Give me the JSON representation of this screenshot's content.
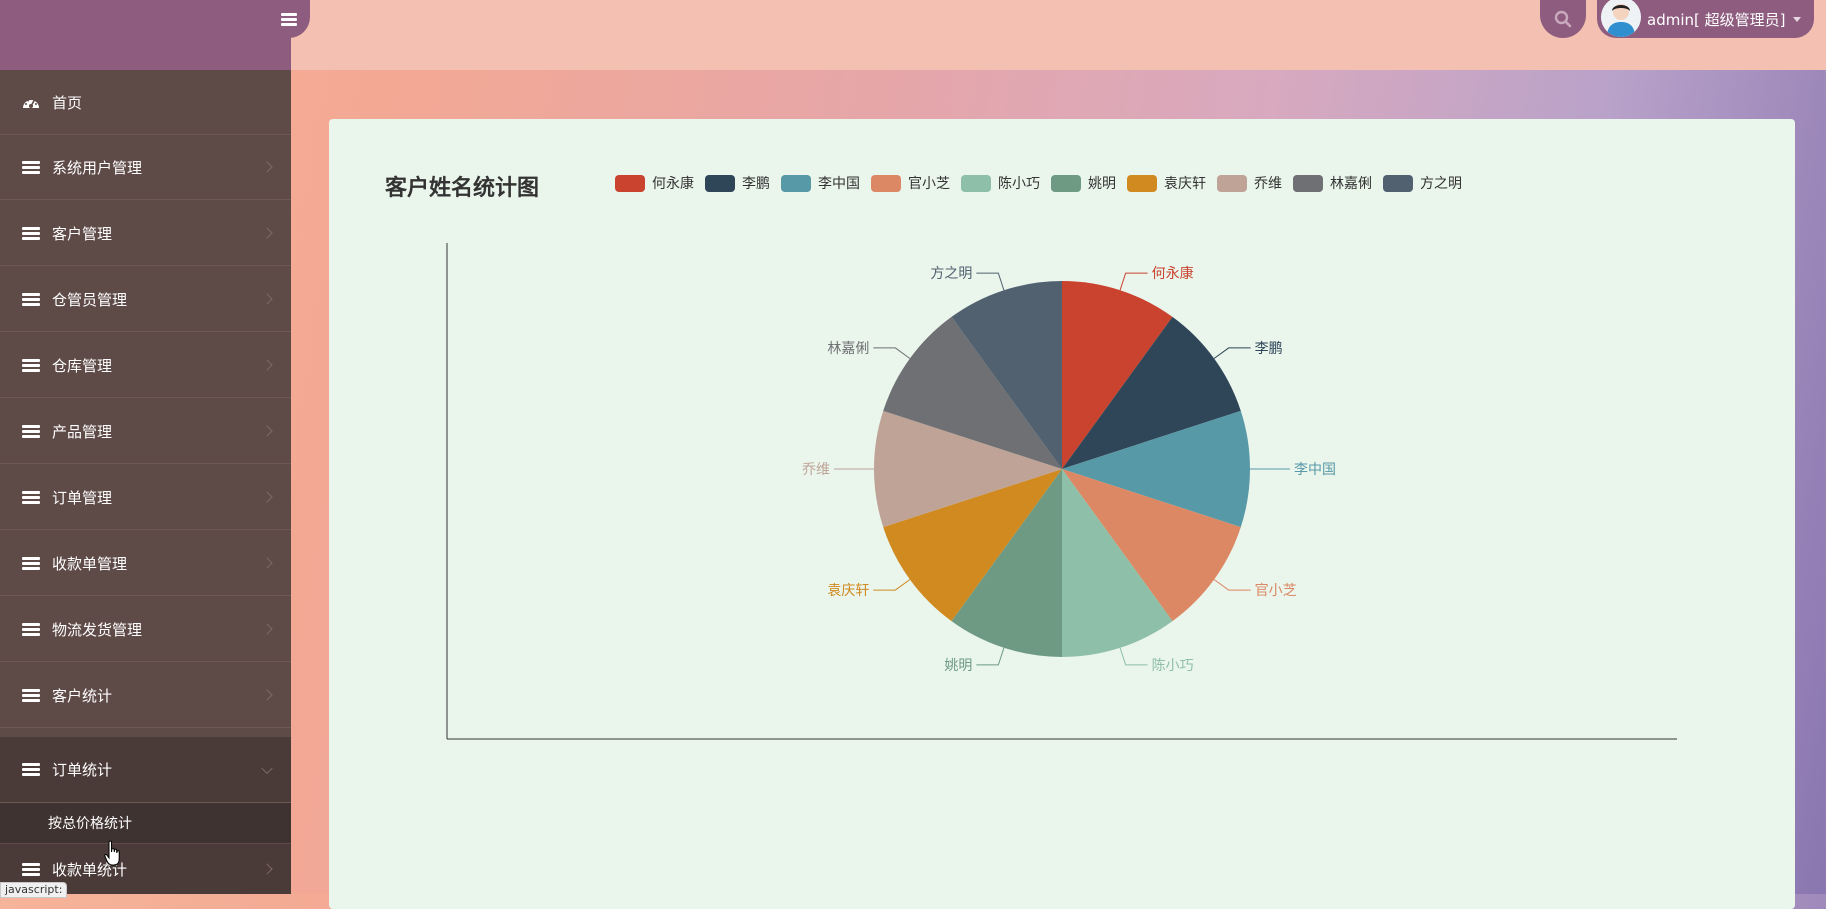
{
  "header": {
    "user_label": "admin[ 超级管理员]"
  },
  "icons": {
    "menu": "bars-icon",
    "search": "search-icon",
    "avatar": "user-avatar-icon",
    "dashboard": "dashboard-icon",
    "module": "stack-icon"
  },
  "sidebar": {
    "items": [
      {
        "label": "首页"
      },
      {
        "label": "系统用户管理"
      },
      {
        "label": "客户管理"
      },
      {
        "label": "仓管员管理"
      },
      {
        "label": "仓库管理"
      },
      {
        "label": "产品管理"
      },
      {
        "label": "订单管理"
      },
      {
        "label": "收款单管理"
      },
      {
        "label": "物流发货管理"
      },
      {
        "label": "客户统计"
      },
      {
        "label": "订单统计"
      },
      {
        "label": "收款单统计"
      }
    ],
    "open_sub": {
      "label": "按总价格统计"
    }
  },
  "status_tip": "javascript:",
  "chart_data": {
    "type": "pie",
    "title": "客户姓名统计图",
    "legend_position": "top",
    "slices": [
      {
        "name": "何永康",
        "value": 1,
        "color": "#c9432f"
      },
      {
        "name": "李鹏",
        "value": 1,
        "color": "#2e4658"
      },
      {
        "name": "李中国",
        "value": 1,
        "color": "#5899a7"
      },
      {
        "name": "官小芝",
        "value": 1,
        "color": "#dc8864"
      },
      {
        "name": "陈小巧",
        "value": 1,
        "color": "#8ebfa9"
      },
      {
        "name": "姚明",
        "value": 1,
        "color": "#6e9a84"
      },
      {
        "name": "袁庆轩",
        "value": 1,
        "color": "#d08a20"
      },
      {
        "name": "乔维",
        "value": 1,
        "color": "#bfa397"
      },
      {
        "name": "林嘉俐",
        "value": 1,
        "color": "#6e7073"
      },
      {
        "name": "方之明",
        "value": 1,
        "color": "#516170"
      }
    ]
  }
}
